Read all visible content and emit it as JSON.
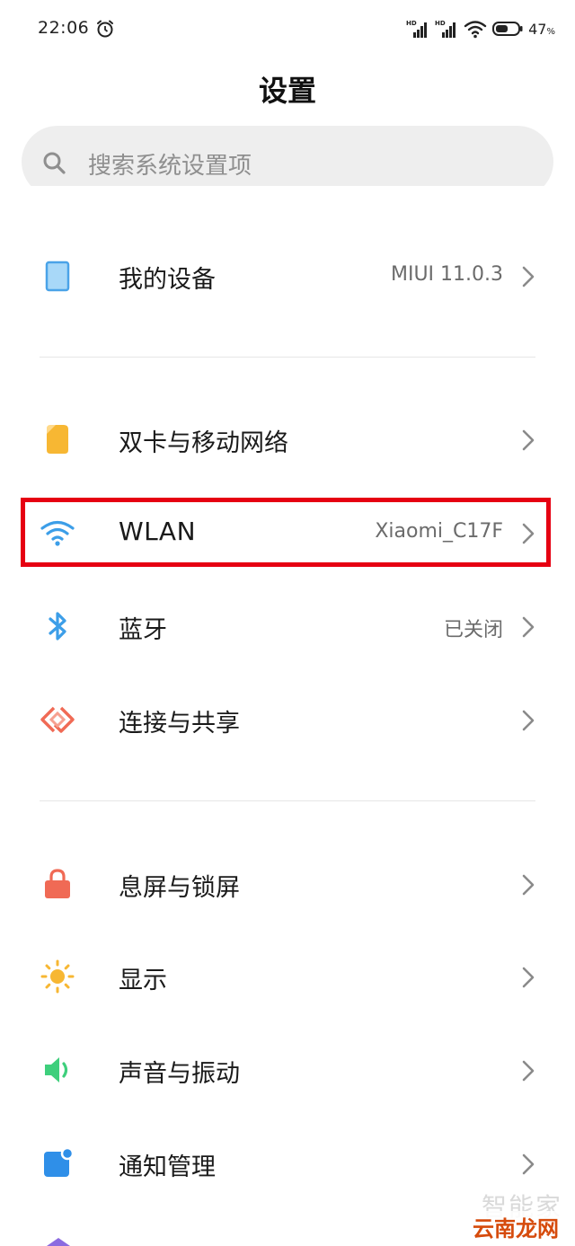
{
  "status": {
    "time": "22:06",
    "battery": "47",
    "battery_unit": "%"
  },
  "title": "设置",
  "search": {
    "placeholder": "搜索系统设置项"
  },
  "rows": [
    {
      "label": "我的设备",
      "value": "MIUI 11.0.3",
      "icon": "tablet-icon"
    },
    {
      "label": "双卡与移动网络",
      "value": "",
      "icon": "sim-card-icon"
    },
    {
      "label": "WLAN",
      "value": "Xiaomi_C17F",
      "icon": "wifi-icon"
    },
    {
      "label": "蓝牙",
      "value": "已关闭",
      "icon": "bluetooth-icon"
    },
    {
      "label": "连接与共享",
      "value": "",
      "icon": "share-icon"
    },
    {
      "label": "息屏与锁屏",
      "value": "",
      "icon": "lock-icon"
    },
    {
      "label": "显示",
      "value": "",
      "icon": "sun-icon"
    },
    {
      "label": "声音与振动",
      "value": "",
      "icon": "speaker-icon"
    },
    {
      "label": "通知管理",
      "value": "",
      "icon": "notification-icon"
    }
  ],
  "colors": {
    "highlight": "#e60012",
    "tablet": "#4aa3e8",
    "sim": "#f7b733",
    "wifi": "#3c9ee8",
    "bluetooth": "#3c9ee8",
    "share": "#f06a55",
    "lock": "#f06a55",
    "sun": "#f7b733",
    "speaker": "#3ecf7c",
    "notification": "#2f8fe8"
  },
  "watermark": {
    "top": "智能家",
    "bottom": "云南龙网"
  }
}
